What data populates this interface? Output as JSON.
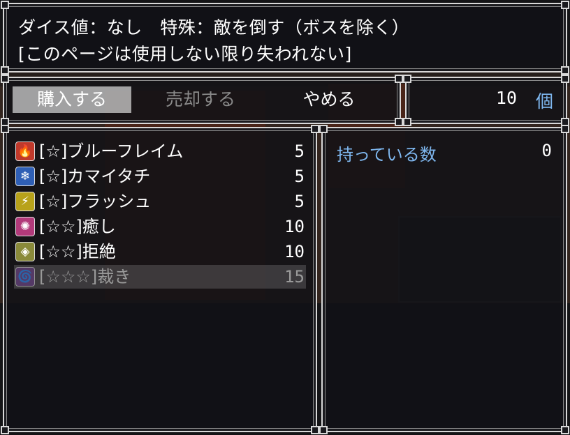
{
  "help": {
    "line1": "ダイス値：なし　特殊：敵を倒す（ボスを除く）",
    "line2": "[このページは使用しない限り失われない]"
  },
  "commands": {
    "buy": "購入する",
    "sell": "売却する",
    "cancel": "やめる"
  },
  "quantity": {
    "value": "10",
    "unit": "個"
  },
  "items": [
    {
      "name": "[☆]ブルーフレイム",
      "price": "5",
      "icon": "flame-icon",
      "color": "#c0392b",
      "glyph": "🔥"
    },
    {
      "name": "[☆]カマイタチ",
      "price": "5",
      "icon": "snowflake-icon",
      "color": "#2f5fb5",
      "glyph": "❄"
    },
    {
      "name": "[☆]フラッシュ",
      "price": "5",
      "icon": "lightning-icon",
      "color": "#b8a21a",
      "glyph": "⚡"
    },
    {
      "name": "[☆☆]癒し",
      "price": "10",
      "icon": "heal-icon",
      "color": "#b23a7a",
      "glyph": "✺"
    },
    {
      "name": "[☆☆]拒絶",
      "price": "10",
      "icon": "shield-icon",
      "color": "#8a8a3a",
      "glyph": "◈"
    },
    {
      "name": "[☆☆☆]裁き",
      "price": "15",
      "icon": "vortex-icon",
      "color": "#6a3a8a",
      "glyph": "🌀"
    }
  ],
  "status": {
    "label": "持っている数",
    "count": "0"
  }
}
